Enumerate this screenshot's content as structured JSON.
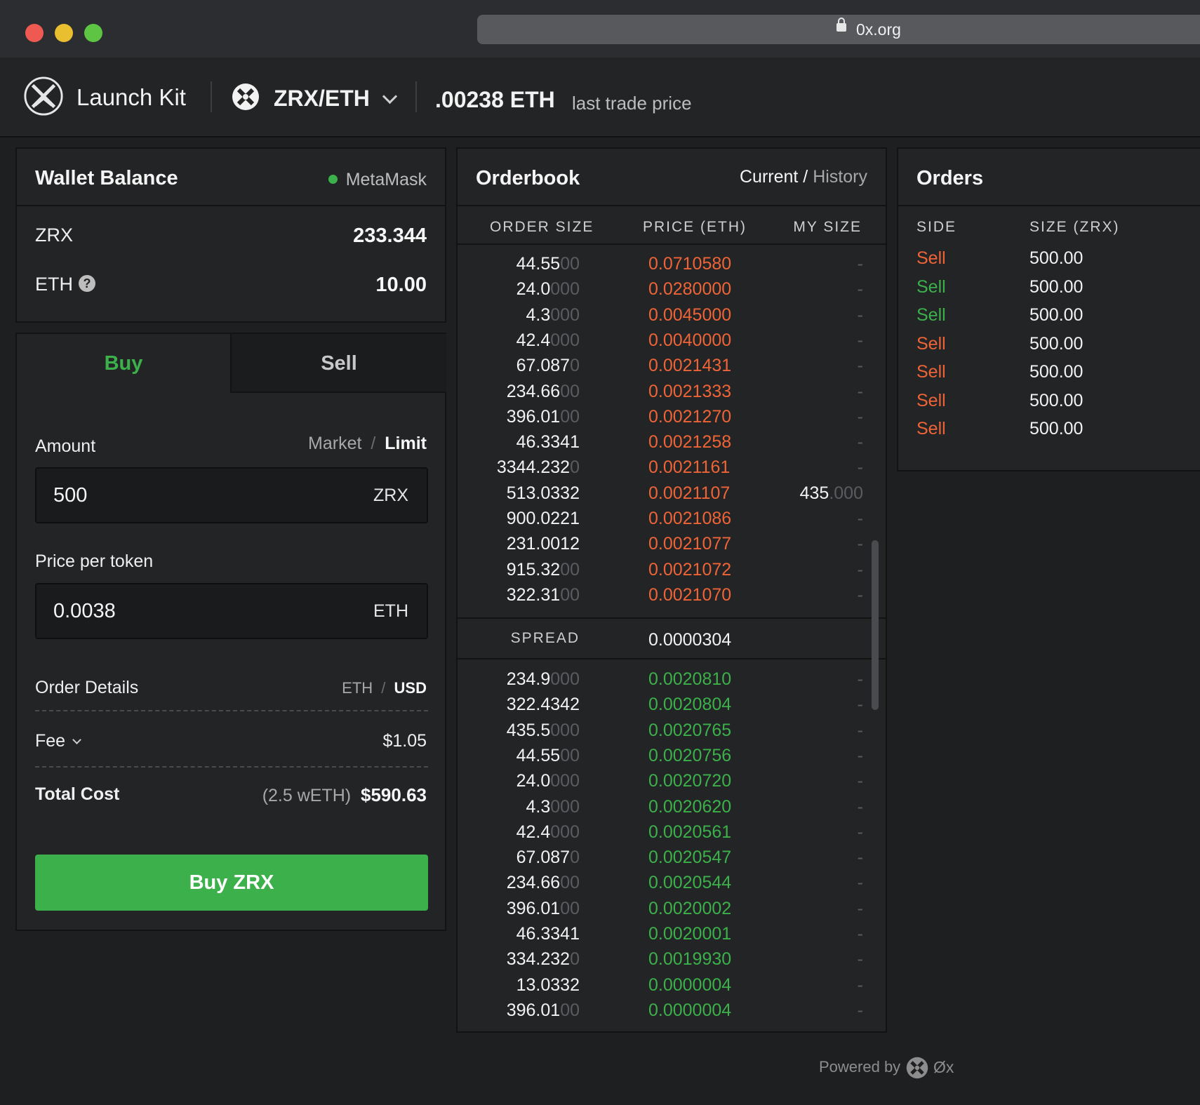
{
  "browser": {
    "url": "0x.org"
  },
  "header": {
    "app_name": "Launch Kit",
    "pair": "ZRX/ETH",
    "last_price": ".00238 ETH",
    "last_price_label": "last trade price"
  },
  "wallet": {
    "title": "Wallet Balance",
    "provider": "MetaMask",
    "provider_status_color": "#3cb04a",
    "balances": [
      {
        "token": "ZRX",
        "amount": "233.344"
      },
      {
        "token": "ETH",
        "amount": "10.00"
      }
    ]
  },
  "trade": {
    "tab_buy": "Buy",
    "tab_sell": "Sell",
    "active_tab": "Buy",
    "amount_label": "Amount",
    "mode_market": "Market",
    "mode_sep": "/",
    "mode_limit": "Limit",
    "active_mode": "Limit",
    "amount_value": "500",
    "amount_unit": "ZRX",
    "price_label": "Price per token",
    "price_value": "0.0038",
    "price_unit": "ETH",
    "details_label": "Order Details",
    "cur_eth": "ETH",
    "cur_sep": "/",
    "cur_usd": "USD",
    "active_currency": "USD",
    "fee_label": "Fee",
    "fee_value": "$1.05",
    "total_label": "Total Cost",
    "total_weth": "(2.5 wETH)",
    "total_value": "$590.63",
    "submit_label": "Buy ZRX",
    "accent_color": "#3cb04a"
  },
  "orderbook": {
    "title": "Orderbook",
    "tab_current": "Current",
    "tab_sep": " / ",
    "tab_history": "History",
    "col_size": "ORDER SIZE",
    "col_price": "PRICE (ETH)",
    "col_my": "MY SIZE",
    "spread_label": "SPREAD",
    "spread_value": "0.0000304",
    "sell_color": "#ee6437",
    "buy_color": "#3cb04a",
    "sells": [
      {
        "size_main": "44.55",
        "size_dim": "00",
        "price": "0.0710580",
        "my_main": "",
        "my_dim": "-"
      },
      {
        "size_main": "24.0",
        "size_dim": "000",
        "price": "0.0280000",
        "my_main": "",
        "my_dim": "-"
      },
      {
        "size_main": "4.3",
        "size_dim": "000",
        "price": "0.0045000",
        "my_main": "",
        "my_dim": "-"
      },
      {
        "size_main": "42.4",
        "size_dim": "000",
        "price": "0.0040000",
        "my_main": "",
        "my_dim": "-"
      },
      {
        "size_main": "67.087",
        "size_dim": "0",
        "price": "0.0021431",
        "my_main": "",
        "my_dim": "-"
      },
      {
        "size_main": "234.66",
        "size_dim": "00",
        "price": "0.0021333",
        "my_main": "",
        "my_dim": "-"
      },
      {
        "size_main": "396.01",
        "size_dim": "00",
        "price": "0.0021270",
        "my_main": "",
        "my_dim": "-"
      },
      {
        "size_main": "46.3341",
        "size_dim": "",
        "price": "0.0021258",
        "my_main": "",
        "my_dim": "-"
      },
      {
        "size_main": "3344.232",
        "size_dim": "0",
        "price": "0.0021161",
        "my_main": "",
        "my_dim": "-"
      },
      {
        "size_main": "513.0332",
        "size_dim": "",
        "price": "0.0021107",
        "my_main": "435",
        "my_dim": ".000"
      },
      {
        "size_main": "900.0221",
        "size_dim": "",
        "price": "0.0021086",
        "my_main": "",
        "my_dim": "-"
      },
      {
        "size_main": "231.0012",
        "size_dim": "",
        "price": "0.0021077",
        "my_main": "",
        "my_dim": "-"
      },
      {
        "size_main": "915.32",
        "size_dim": "00",
        "price": "0.0021072",
        "my_main": "",
        "my_dim": "-"
      },
      {
        "size_main": "322.31",
        "size_dim": "00",
        "price": "0.0021070",
        "my_main": "",
        "my_dim": "-"
      }
    ],
    "buys": [
      {
        "size_main": "234.9",
        "size_dim": "000",
        "price": "0.0020810",
        "my_main": "",
        "my_dim": "-"
      },
      {
        "size_main": "322.4342",
        "size_dim": "",
        "price": "0.0020804",
        "my_main": "",
        "my_dim": "-"
      },
      {
        "size_main": "435.5",
        "size_dim": "000",
        "price": "0.0020765",
        "my_main": "",
        "my_dim": "-"
      },
      {
        "size_main": "44.55",
        "size_dim": "00",
        "price": "0.0020756",
        "my_main": "",
        "my_dim": "-"
      },
      {
        "size_main": "24.0",
        "size_dim": "000",
        "price": "0.0020720",
        "my_main": "",
        "my_dim": "-"
      },
      {
        "size_main": "4.3",
        "size_dim": "000",
        "price": "0.0020620",
        "my_main": "",
        "my_dim": "-"
      },
      {
        "size_main": "42.4",
        "size_dim": "000",
        "price": "0.0020561",
        "my_main": "",
        "my_dim": "-"
      },
      {
        "size_main": "67.087",
        "size_dim": "0",
        "price": "0.0020547",
        "my_main": "",
        "my_dim": "-"
      },
      {
        "size_main": "234.66",
        "size_dim": "00",
        "price": "0.0020544",
        "my_main": "",
        "my_dim": "-"
      },
      {
        "size_main": "396.01",
        "size_dim": "00",
        "price": "0.0020002",
        "my_main": "",
        "my_dim": "-"
      },
      {
        "size_main": "46.3341",
        "size_dim": "",
        "price": "0.0020001",
        "my_main": "",
        "my_dim": "-"
      },
      {
        "size_main": "334.232",
        "size_dim": "0",
        "price": "0.0019930",
        "my_main": "",
        "my_dim": "-"
      },
      {
        "size_main": "13.0332",
        "size_dim": "",
        "price": "0.0000004",
        "my_main": "",
        "my_dim": "-"
      },
      {
        "size_main": "396.01",
        "size_dim": "00",
        "price": "0.0000004",
        "my_main": "",
        "my_dim": "-"
      }
    ]
  },
  "orders": {
    "title": "Orders",
    "col_side": "SIDE",
    "col_size": "SIZE (ZRX)",
    "rows": [
      {
        "side": "Sell",
        "size": "500.00",
        "color": "#ee6437"
      },
      {
        "side": "Sell",
        "size": "500.00",
        "color": "#3cb04a"
      },
      {
        "side": "Sell",
        "size": "500.00",
        "color": "#3cb04a"
      },
      {
        "side": "Sell",
        "size": "500.00",
        "color": "#ee6437"
      },
      {
        "side": "Sell",
        "size": "500.00",
        "color": "#ee6437"
      },
      {
        "side": "Sell",
        "size": "500.00",
        "color": "#ee6437"
      },
      {
        "side": "Sell",
        "size": "500.00",
        "color": "#ee6437"
      }
    ]
  },
  "footer": {
    "powered_by": "Powered by",
    "brand": "Øx"
  }
}
